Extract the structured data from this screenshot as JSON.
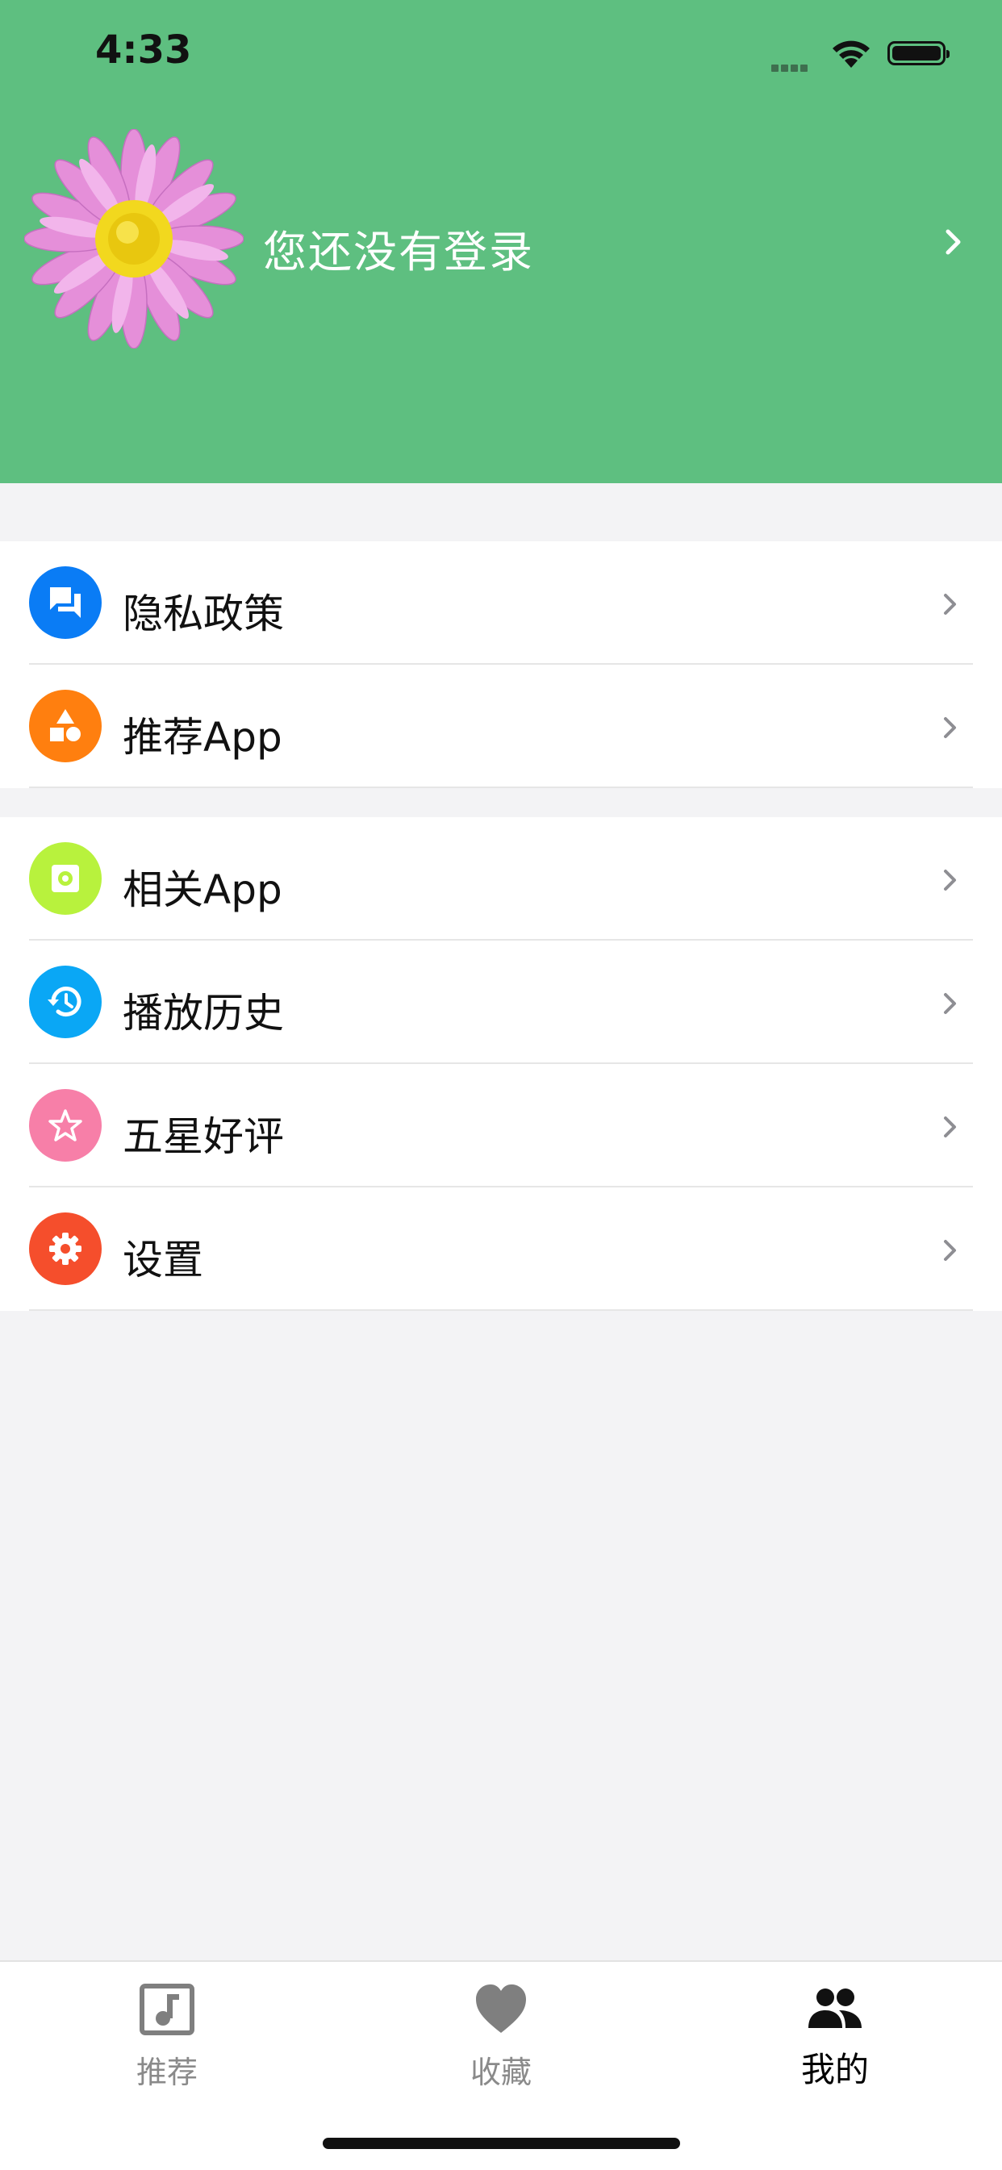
{
  "status_bar": {
    "time": "4:33"
  },
  "profile": {
    "login_prompt": "您还没有登录"
  },
  "menu_groups": [
    [
      {
        "label": "隐私政策",
        "icon": "chat-icon",
        "color": "#0a7cf5"
      },
      {
        "label": "推荐App",
        "icon": "shapes-icon",
        "color": "#ff7f0f"
      }
    ],
    [
      {
        "label": "相关App",
        "icon": "app-icon",
        "color": "#b8f23d"
      },
      {
        "label": "播放历史",
        "icon": "history-icon",
        "color": "#0aa7f5"
      },
      {
        "label": "五星好评",
        "icon": "star-icon",
        "color": "#f77fa8"
      },
      {
        "label": "设置",
        "icon": "gear-icon",
        "color": "#f54e2c"
      }
    ]
  ],
  "tabs": [
    {
      "label": "推荐",
      "icon": "music-note-icon",
      "active": false
    },
    {
      "label": "收藏",
      "icon": "heart-icon",
      "active": false
    },
    {
      "label": "我的",
      "icon": "people-icon",
      "active": true
    }
  ],
  "colors": {
    "header": "#5ebf80",
    "background": "#f3f3f5"
  }
}
